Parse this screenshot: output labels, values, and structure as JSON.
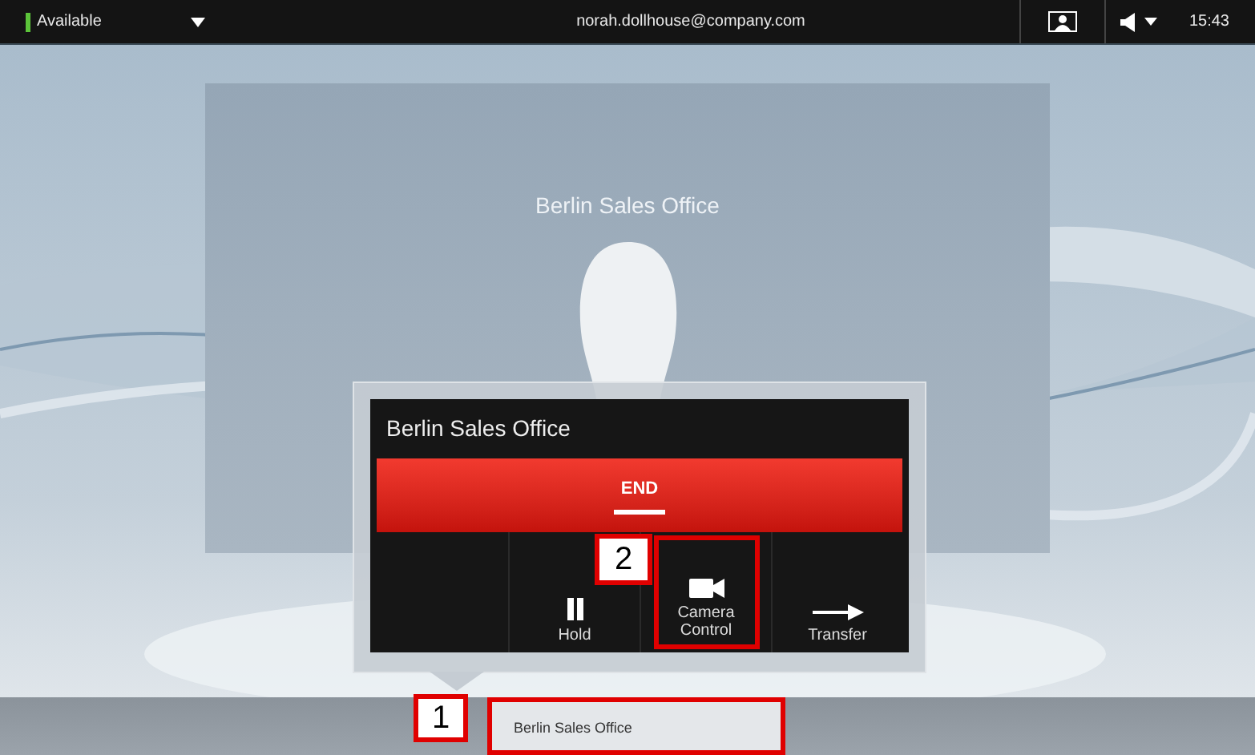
{
  "status_bar": {
    "presence": "Available",
    "user": "norah.dollhouse@company.com",
    "time": "15:43"
  },
  "video": {
    "caller_name": "Berlin Sales Office"
  },
  "call_menu": {
    "title": "Berlin Sales Office",
    "end_label": "END",
    "actions": [
      {
        "kind": "empty"
      },
      {
        "kind": "hold",
        "label": "Hold"
      },
      {
        "kind": "camera",
        "label": "Camera Control",
        "callout": "2"
      },
      {
        "kind": "transfer",
        "label": "Transfer"
      }
    ]
  },
  "call_tab": {
    "label": "Berlin Sales Office",
    "selected": true,
    "callout": "1"
  }
}
